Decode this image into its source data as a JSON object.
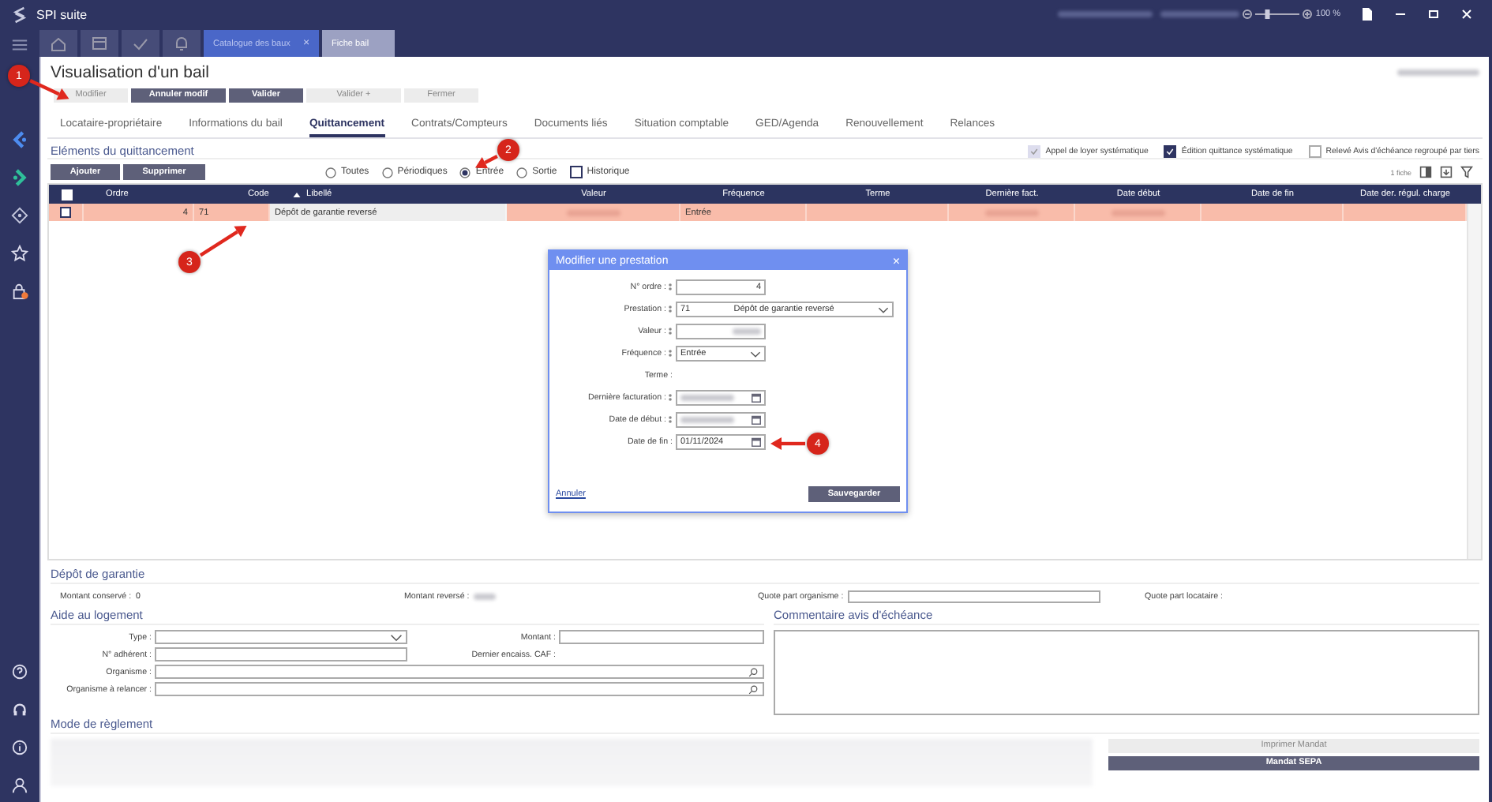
{
  "app": {
    "title": "SPI suite",
    "zoom": "100 %",
    "zoom_slider": {
      "level": 0.25
    }
  },
  "doc_tabs": [
    {
      "label": "Catalogue des baux",
      "close": "×",
      "selected": false
    },
    {
      "label": "Fiche bail",
      "selected": true
    }
  ],
  "page": {
    "title": "Visualisation d'un bail"
  },
  "actions": [
    {
      "label": "Modifier",
      "disabled": true
    },
    {
      "label": "Annuler modif",
      "disabled": false
    },
    {
      "label": "Valider",
      "disabled": false
    },
    {
      "label": "Valider +",
      "disabled": true
    },
    {
      "label": "Fermer",
      "disabled": true
    }
  ],
  "tabs": [
    {
      "label": "Locataire-propriétaire",
      "selected": false
    },
    {
      "label": "Informations du bail",
      "selected": false
    },
    {
      "label": "Quittancement",
      "selected": true
    },
    {
      "label": "Contrats/Compteurs",
      "selected": false
    },
    {
      "label": "Documents liés",
      "selected": false
    },
    {
      "label": "Situation comptable",
      "selected": false
    },
    {
      "label": "GED/Agenda",
      "selected": false
    },
    {
      "label": "Renouvellement",
      "selected": false
    },
    {
      "label": "Relances",
      "selected": false
    }
  ],
  "section": {
    "title": "Eléments du quittancement"
  },
  "options": [
    {
      "label": "Appel de loyer systématique",
      "checked": true,
      "disabled": true
    },
    {
      "label": "Édition quittance systématique",
      "checked": true,
      "disabled": false
    },
    {
      "label": "Relevé Avis d'échéance regroupé par tiers",
      "checked": false,
      "disabled": false
    }
  ],
  "list_buttons": [
    "Ajouter",
    "Supprimer"
  ],
  "filters": [
    {
      "label": "Toutes",
      "selected": false
    },
    {
      "label": "Périodiques",
      "selected": false
    },
    {
      "label": "Entrée",
      "selected": true
    },
    {
      "label": "Sortie",
      "selected": false
    }
  ],
  "history": {
    "label": "Historique",
    "checked": false
  },
  "count": "1 fiche",
  "table": {
    "all_checked": false,
    "columns": [
      {
        "label": "Ordre",
        "sorted": false
      },
      {
        "label": "Code",
        "sorted": false
      },
      {
        "label": "Libellé",
        "sorted": true
      },
      {
        "label": "Valeur",
        "sorted": false
      },
      {
        "label": "Fréquence",
        "sorted": false
      },
      {
        "label": "Terme",
        "sorted": false
      },
      {
        "label": "Dernière fact.",
        "sorted": false
      },
      {
        "label": "Date début",
        "sorted": false
      },
      {
        "label": "Date de fin",
        "sorted": false
      },
      {
        "label": "Date der. régul. charge",
        "sorted": false
      }
    ],
    "rows": [
      {
        "checked": false,
        "selected": true,
        "cells": [
          {
            "text": "4"
          },
          {
            "text": "71"
          },
          {
            "text": "Dépôt de garantie reversé"
          },
          {
            "blurred": true
          },
          {
            "text": "Entrée"
          },
          {},
          {
            "blurred": true
          },
          {
            "blurred": true
          },
          {},
          {}
        ]
      }
    ]
  },
  "modal": {
    "title": "Modifier une prestation",
    "close": "×",
    "fields": [
      {
        "label": "N° ordre :",
        "required": true,
        "kind": "number",
        "value": "4"
      },
      {
        "label": "Prestation :",
        "required": true,
        "kind": "select",
        "value": "71",
        "detail": "Dépôt de garantie reversé"
      },
      {
        "label": "Valeur :",
        "required": true,
        "kind": "text",
        "blurred": true
      },
      {
        "label": "Fréquence :",
        "required": true,
        "kind": "select",
        "value": "Entrée"
      },
      {
        "label": "Terme :",
        "required": false,
        "kind": "none"
      },
      {
        "label": "Dernière facturation :",
        "required": true,
        "kind": "date",
        "blurred": true
      },
      {
        "label": "Date de début :",
        "required": true,
        "kind": "date",
        "blurred": true
      },
      {
        "label": "Date de fin :",
        "required": false,
        "kind": "date",
        "value": "01/11/2024"
      }
    ],
    "cancel": "Annuler",
    "save": "Sauvegarder"
  },
  "deposit": {
    "title": "Dépôt de garantie",
    "fields": [
      {
        "label": "Montant conservé :",
        "kind": "value",
        "value": "0"
      },
      {
        "label": "Montant reversé :",
        "kind": "blurred"
      },
      {
        "label": "Quote part organisme :",
        "kind": "input"
      },
      {
        "label": "Quote part locataire :",
        "kind": "value"
      }
    ]
  },
  "housing": {
    "title": "Aide au logement",
    "fields": [
      {
        "label": "Type :",
        "kind": "select"
      },
      {
        "label": "Montant :",
        "kind": "input"
      },
      {
        "label": "N° adhérent :",
        "kind": "input"
      },
      {
        "label": "Dernier encaiss. CAF :",
        "kind": "value"
      },
      {
        "label": "Organisme :",
        "kind": "search"
      },
      {
        "label": "Organisme à relancer :",
        "kind": "search"
      }
    ]
  },
  "comment": {
    "title": "Commentaire avis d'échéance"
  },
  "payment": {
    "title": "Mode de règlement",
    "buttons": [
      {
        "label": "Imprimer Mandat",
        "disabled": true
      },
      {
        "label": "Mandat SEPA",
        "disabled": false
      }
    ]
  },
  "annotations": [
    {
      "number": "1"
    },
    {
      "number": "2"
    },
    {
      "number": "3"
    },
    {
      "number": "4"
    }
  ]
}
